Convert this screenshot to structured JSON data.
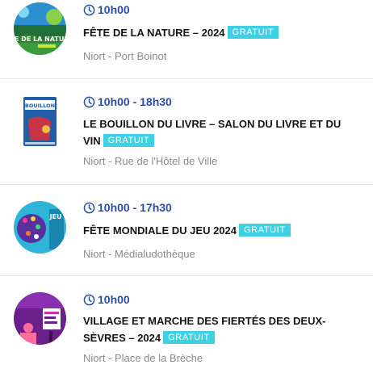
{
  "events": [
    {
      "time": "10h00",
      "title": "FÊTE DE LA NATURE – 2024",
      "badge": "GRATUIT",
      "location": "Niort - Port Boinot",
      "thumb_text": "TE DE LA NATUR"
    },
    {
      "time": "10h00 - 18h30",
      "title_line1": "LE BOUILLON DU LIVRE – SALON DU LIVRE ET DU",
      "title_line2": "VIN",
      "badge": "GRATUIT",
      "location": "Niort - Rue de l'Hôtel de Ville",
      "thumb_text": "BOUILLON"
    },
    {
      "time": "10h00 - 17h30",
      "title": "FÊTE MONDIALE DU JEU 2024",
      "badge": "GRATUIT",
      "location": "Niort - Médialudothèque"
    },
    {
      "time": "10h00",
      "title_line1": "VILLAGE ET MARCHE DES FIERTÉS DES DEUX-",
      "title_line2": "SÈVRES – 2024",
      "badge": "GRATUIT",
      "location": "Niort - Place de la Brèche"
    }
  ],
  "colors": {
    "time": "#2a4f9c",
    "badge": "#3fd0e3",
    "location": "#8a8a8a",
    "divider": "#e6e6e6"
  },
  "icons": {
    "time": "clock-icon"
  }
}
